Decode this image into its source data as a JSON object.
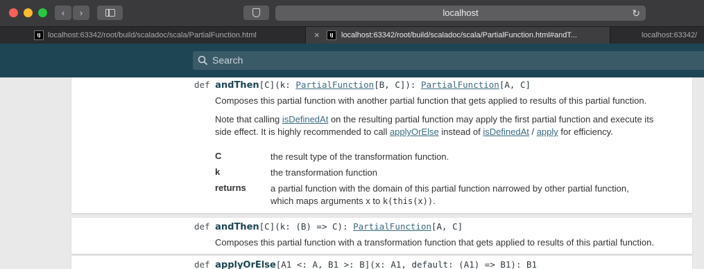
{
  "browser": {
    "url": "localhost",
    "tabs": [
      {
        "favicon": "IJ",
        "label": "localhost:63342/root/build/scaladoc/scala/PartialFunction.html"
      },
      {
        "favicon": "IJ",
        "label": "localhost:63342/root/build/scaladoc/scala/PartialFunction.html#andT..."
      },
      {
        "label": "localhost:63342/"
      }
    ],
    "close_glyph": "×",
    "reload_glyph": "↻"
  },
  "search": {
    "placeholder": "Search"
  },
  "members": [
    {
      "keyword": "def",
      "name": "andThen",
      "sig_part1": "[C](k: ",
      "sig_link1": "PartialFunction",
      "sig_part2": "[B, C]): ",
      "sig_link2": "PartialFunction",
      "sig_part3": "[A, C]",
      "summary": "Composes this partial function with another partial function that gets applied to results of this partial function.",
      "note": {
        "t1": "Note that calling ",
        "l1": "isDefinedAt",
        "t2": " on the resulting partial function may apply the first partial function and execute its",
        "t3": "side effect. It is highly recommended to call ",
        "l2": "applyOrElse",
        "t4": " instead of ",
        "l3": "isDefinedAt",
        "t5": " / ",
        "l4": "apply",
        "t6": " for efficiency."
      },
      "params": [
        {
          "name": "C",
          "desc": "the result type of the transformation function."
        },
        {
          "name": "k",
          "desc": "the transformation function"
        }
      ],
      "returns": {
        "name": "returns",
        "line1": "a partial function with the domain of this partial function narrowed by other partial function,",
        "line2a": "which maps arguments x to ",
        "line2code": "k(this(x))",
        "line2b": "."
      }
    },
    {
      "keyword": "def",
      "name": "andThen",
      "sig_part1": "[C](k: (B) => C): ",
      "sig_link1": "PartialFunction",
      "sig_part2": "[A, C]",
      "summary": "Composes this partial function with a transformation function that gets applied to results of this partial function."
    },
    {
      "keyword": "def",
      "name": "applyOrElse",
      "sig_part1": "[A1 <: A, B1 >: B](x: A1, default: (A1) => B1): B1"
    }
  ]
}
